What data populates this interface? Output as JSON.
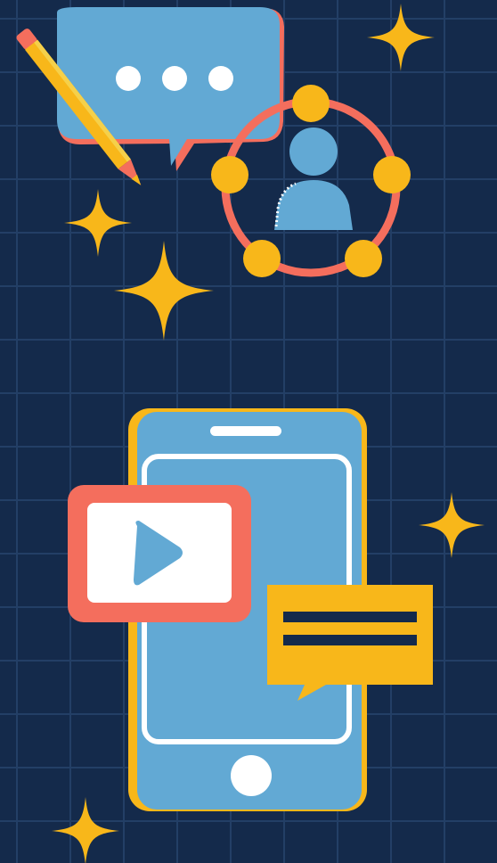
{
  "colors": {
    "background": "#142a4b",
    "grid": "#233f66",
    "blue": "#62a9d4",
    "gold": "#f8b71a",
    "coral": "#f46e5d",
    "white": "#ffffff",
    "navy": "#142a4b"
  },
  "icons": {
    "top": [
      "speech-bubble-icon",
      "pencil-icon",
      "user-network-icon"
    ],
    "bottom": [
      "smartphone-icon",
      "video-player-icon",
      "chat-message-icon"
    ],
    "decor": "sparkle-icon"
  }
}
